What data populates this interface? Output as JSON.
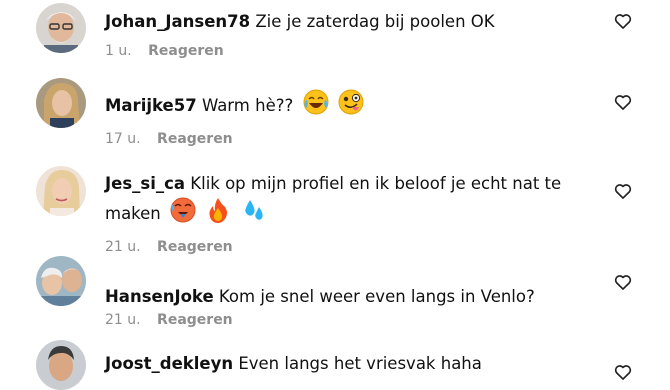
{
  "comments": [
    {
      "username": "Johan_Jansen78",
      "text": "Zie je zaterdag bij poolen OK",
      "time": "1 u.",
      "reply_label": "Reageren",
      "emojis": []
    },
    {
      "username": "Marijke57",
      "text": "Warm hè??",
      "time": "17 u.",
      "reply_label": "Reageren",
      "emojis": [
        "tears-of-joy-emoji",
        "zany-face-emoji"
      ]
    },
    {
      "username": "Jes_si_ca",
      "text": "Klik op mijn profiel en ik beloof je echt nat te maken",
      "time": "21 u.",
      "reply_label": "Reageren",
      "emojis": [
        "hot-face-emoji",
        "fire-emoji",
        "sweat-droplets-emoji"
      ]
    },
    {
      "username": "HansenJoke",
      "text": "Kom je snel weer even langs in Venlo?",
      "time": "21 u.",
      "reply_label": "Reageren",
      "emojis": []
    },
    {
      "username": "Joost_dekleyn",
      "text": "Even langs het vriesvak haha",
      "time": "",
      "reply_label": "",
      "emojis": []
    }
  ],
  "icons": {
    "like": "heart-outline-icon"
  },
  "colors": {
    "text": "#111111",
    "meta": "#8e8e8e",
    "background": "#ffffff"
  }
}
